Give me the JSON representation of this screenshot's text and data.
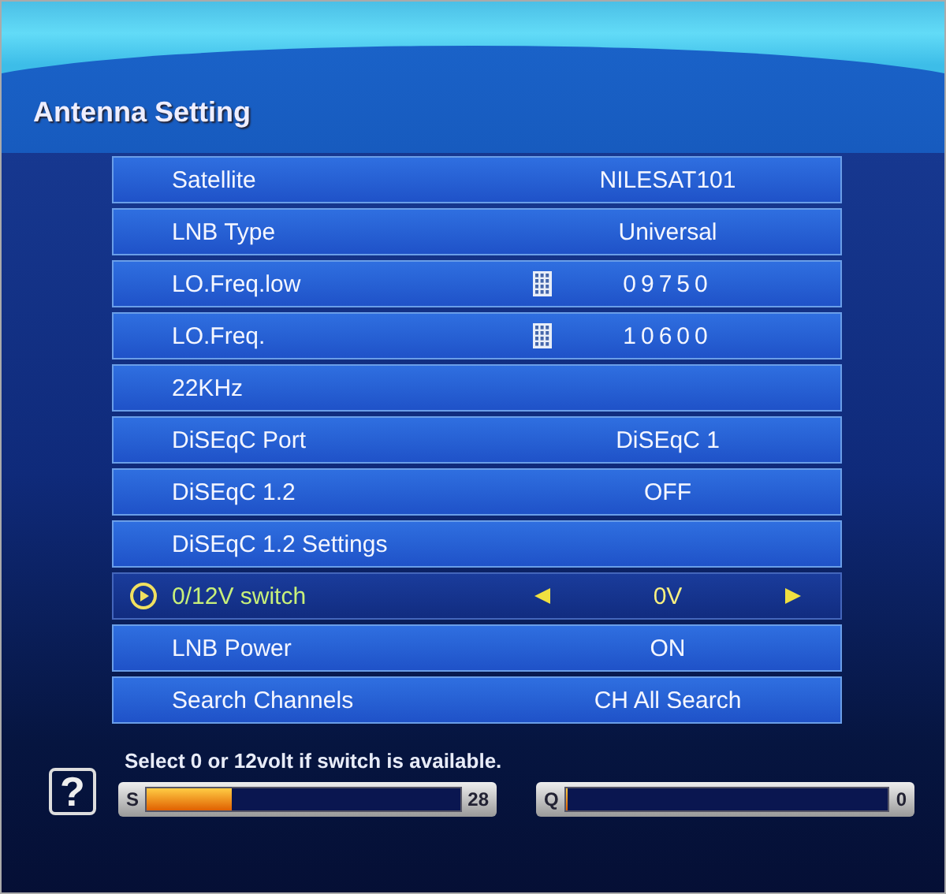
{
  "title": "Antenna Setting",
  "rows": [
    {
      "label": "Satellite",
      "value": "NILESAT101",
      "kind": "plain",
      "selected": false
    },
    {
      "label": "LNB Type",
      "value": "Universal",
      "kind": "plain",
      "selected": false
    },
    {
      "label": "LO.Freq.low",
      "value": "09750",
      "kind": "keypad",
      "selected": false
    },
    {
      "label": "LO.Freq.",
      "value": "10600",
      "kind": "keypad",
      "selected": false
    },
    {
      "label": "22KHz",
      "kind": "plain",
      "selected": false
    },
    {
      "label": "DiSEqC Port",
      "value": "DiSEqC 1",
      "kind": "plain",
      "selected": false
    },
    {
      "label": "DiSEqC 1.2",
      "value": "OFF",
      "kind": "plain",
      "selected": false
    },
    {
      "label": "DiSEqC 1.2 Settings",
      "kind": "plain",
      "selected": false
    },
    {
      "label": "0/12V switch",
      "value": "0V",
      "kind": "selector",
      "selected": true
    },
    {
      "label": "LNB Power",
      "value": "ON",
      "kind": "plain",
      "selected": false
    },
    {
      "label": "Search Channels",
      "value": "CH All Search",
      "kind": "plain",
      "selected": false
    }
  ],
  "help": {
    "glyph": "?",
    "text": "Select 0 or 12volt if switch is available."
  },
  "meters": [
    {
      "label": "S",
      "level": 0.27,
      "reading": "28"
    },
    {
      "label": "Q",
      "level": 0,
      "reading": "0"
    }
  ]
}
